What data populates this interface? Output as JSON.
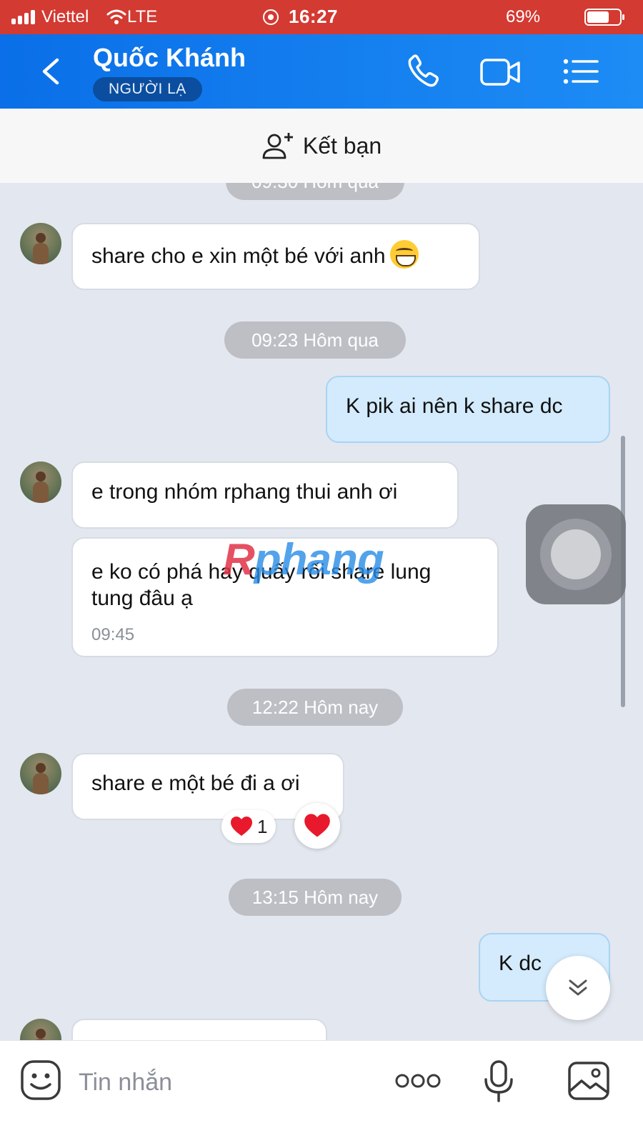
{
  "status_bar": {
    "carrier": "Viettel",
    "network": "LTE",
    "time": "16:27",
    "battery": "69%",
    "battery_level": 0.69
  },
  "header": {
    "contact_name": "Quốc Khánh",
    "stranger_tag": "NGƯỜI LẠ"
  },
  "add_friend": {
    "label": "Kết bạn"
  },
  "chat": {
    "top_time_partial": "09:30 Hôm qua",
    "messages": [
      {
        "text": "share cho e xin một bé với anh",
        "sender": "them",
        "emoji": "grinning-face"
      },
      {
        "time_pill": "09:23 Hôm qua"
      },
      {
        "text": "K pik ai nên k share dc",
        "sender": "me"
      },
      {
        "text": "e trong nhóm rphang thui anh ơi",
        "sender": "them"
      },
      {
        "text": "e ko có phá hay quấy rối share lung tung đâu ạ",
        "sender": "them",
        "time": "09:45"
      },
      {
        "time_pill": "12:22 Hôm nay"
      },
      {
        "text": "share e một bé đi a ơi",
        "sender": "them",
        "reaction_count": "1"
      },
      {
        "time_pill": "13:15 Hôm nay"
      },
      {
        "text": "K dc",
        "sender": "me"
      }
    ],
    "watermark": {
      "r": "R",
      "rest": "phang"
    }
  },
  "input_bar": {
    "placeholder": "Tin nhắn"
  },
  "colors": {
    "status_bar": "#d33a32",
    "header": "#0a6fe8",
    "chat_background": "#e3e7ef",
    "my_bubble": "#d3ebfc",
    "time_pill": "#bdbfc5",
    "heart": "#e8192c"
  },
  "icons": [
    "back-icon",
    "phone-icon",
    "video-call-icon",
    "menu-list-icon",
    "add-friend-icon",
    "sticker-icon",
    "more-icon",
    "microphone-icon",
    "image-icon",
    "double-chevron-down-icon",
    "heart-icon"
  ]
}
